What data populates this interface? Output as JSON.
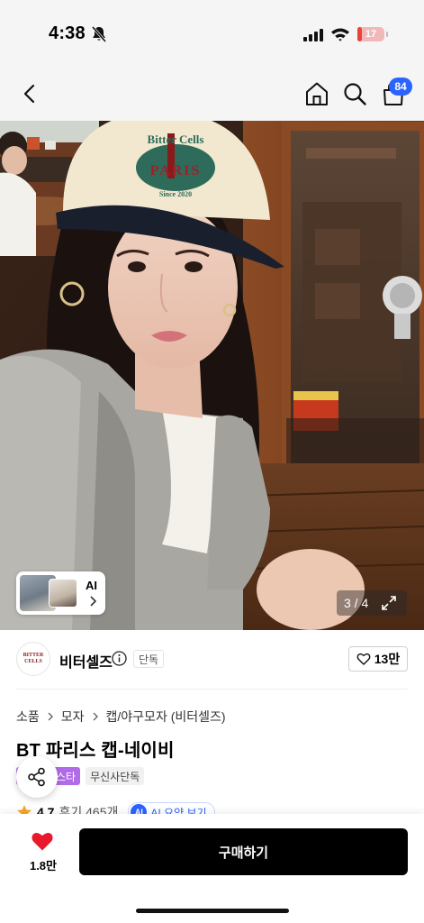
{
  "status_bar": {
    "time": "4:38",
    "battery_level": "17",
    "battery_percent": 17,
    "icons": [
      "bell-slash-icon",
      "cellular-signal-icon",
      "wifi-icon",
      "battery-icon"
    ]
  },
  "nav": {
    "icons": [
      "back-chevron-icon",
      "home-icon",
      "search-icon",
      "shopping-bag-icon"
    ],
    "cart_count": "84"
  },
  "gallery": {
    "page_indicator": "3 / 4",
    "thumbnail_ai_label": "AI",
    "hat_text": [
      "Bitter Cells",
      "PARIS",
      "Since 2020"
    ]
  },
  "brand": {
    "logo_text": [
      "BITTER",
      "CELLS"
    ],
    "name": "비터셀즈",
    "badge": "단독",
    "like_count": "13만"
  },
  "breadcrumb": [
    "소품",
    "모자",
    "캡/야구모자 (비터셀즈)"
  ],
  "product": {
    "title": "BT 파리스 캡-네이비",
    "tags": [
      {
        "label": "스타",
        "color": "#b26be8"
      },
      {
        "label": "무신사단독",
        "color": "#f1f1f1"
      }
    ],
    "rating": "4.7",
    "review_count": "후기 465개",
    "ai_badge": "AI",
    "ai_summary_label": "AI 요약 보기"
  },
  "bottom_bar": {
    "wish_count": "1.8만",
    "buy_label": "구매하기"
  },
  "colors": {
    "accent_blue": "#2b63ff",
    "heart_red": "#e8192c",
    "buy_button": "#000000",
    "battery_red": "#e8443a",
    "tag_purple": "#b26be8"
  }
}
